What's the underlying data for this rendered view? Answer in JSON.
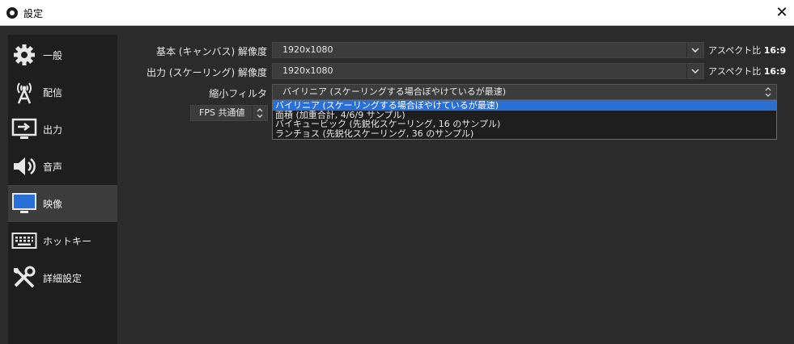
{
  "window": {
    "title": "設定",
    "close_glyph": "✕"
  },
  "sidebar": {
    "items": [
      {
        "label": "一般",
        "icon": "gear-icon"
      },
      {
        "label": "配信",
        "icon": "broadcast-antenna-icon"
      },
      {
        "label": "出力",
        "icon": "output-monitor-icon"
      },
      {
        "label": "音声",
        "icon": "speaker-icon"
      },
      {
        "label": "映像",
        "icon": "monitor-icon"
      },
      {
        "label": "ホットキー",
        "icon": "keyboard-icon"
      },
      {
        "label": "詳細設定",
        "icon": "tools-icon"
      }
    ],
    "active_index": 4
  },
  "video": {
    "base_resolution": {
      "label": "基本 (キャンバス) 解像度",
      "value": "1920x1080",
      "aspect_label": "アスペクト比",
      "aspect_value": "16:9"
    },
    "output_resolution": {
      "label": "出力 (スケーリング) 解像度",
      "value": "1920x1080",
      "aspect_label": "アスペクト比",
      "aspect_value": "16:9"
    },
    "downscale_filter": {
      "label": "縮小フィルタ",
      "value": "バイリニア (スケーリングする場合ぼやけているが最速)",
      "options": [
        "バイリニア (スケーリングする場合ぼやけているが最速)",
        "面積 (加重合計, 4/6/9 サンプル)",
        "バイキュービック (先鋭化スケーリング, 16 のサンプル)",
        "ランチョス (先鋭化スケーリング, 36 のサンプル)"
      ],
      "selected_index": 0
    },
    "fps": {
      "value": "FPS 共通値"
    }
  },
  "colors": {
    "background": "#2b2b2b",
    "sidebar": "#1e1e1e",
    "selection": "#2a6fd6",
    "field": "#3c3c3c"
  }
}
